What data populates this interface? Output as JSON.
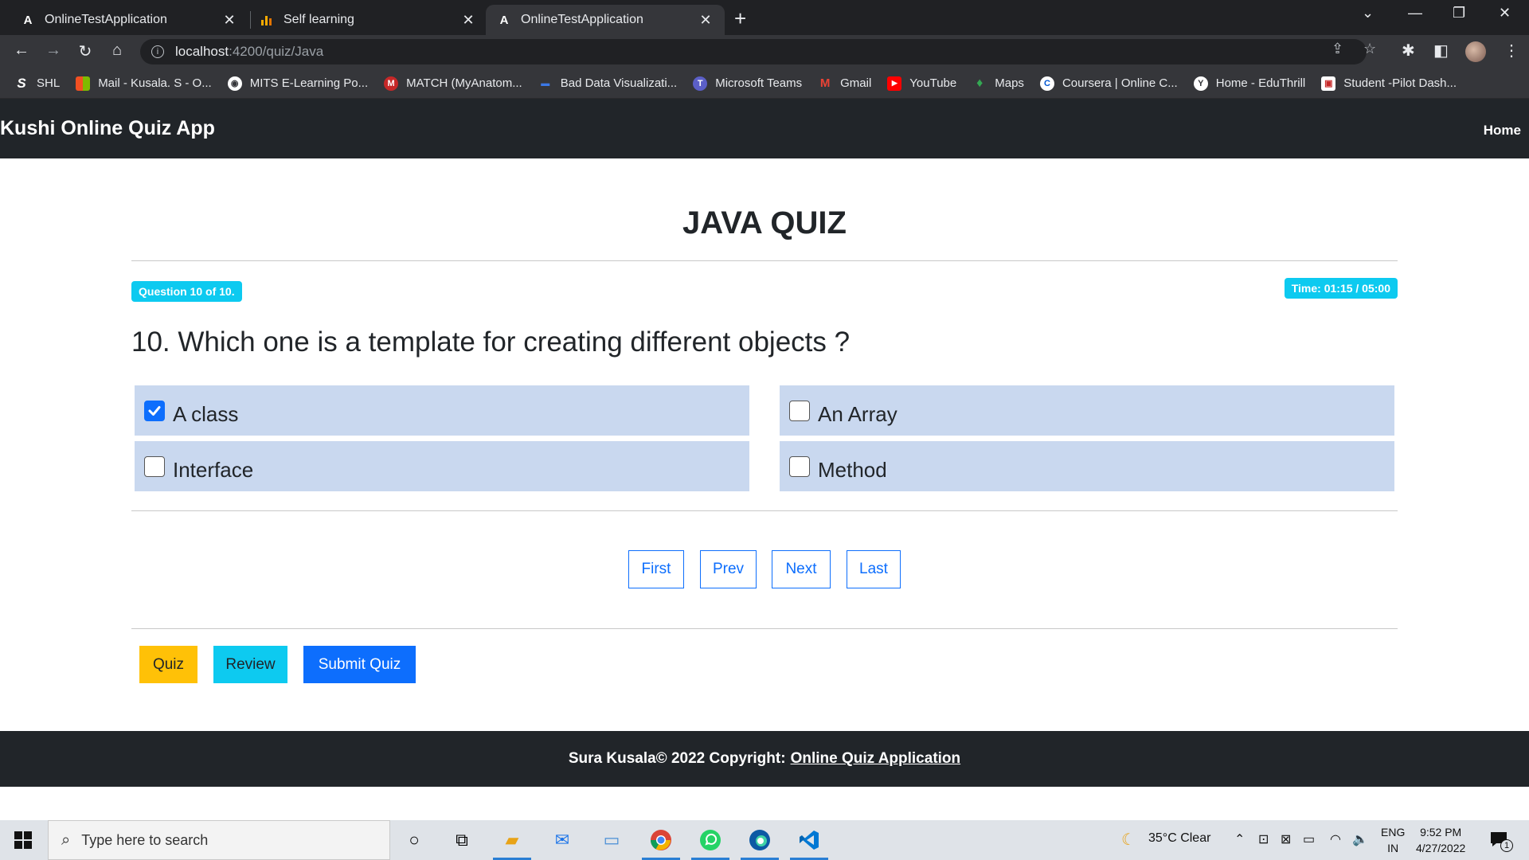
{
  "browser": {
    "tabs": [
      {
        "title": "OnlineTestApplication",
        "icon": "angular-icon"
      },
      {
        "title": "Self learning",
        "icon": "chart-icon"
      },
      {
        "title": "OnlineTestApplication",
        "icon": "angular-icon",
        "active": true
      }
    ],
    "address": {
      "host": "localhost",
      "path": ":4200/quiz/Java"
    },
    "bookmarks": [
      {
        "label": "SHL",
        "icon": "S",
        "color": "#35363a"
      },
      {
        "label": "Mail - Kusala. S - O...",
        "icon": "▦",
        "color": "#f25022"
      },
      {
        "label": "MITS E-Learning Po...",
        "icon": "◉",
        "color": "#35363a"
      },
      {
        "label": "MATCH (MyAnatom...",
        "icon": "M",
        "color": "#c62828"
      },
      {
        "label": "Bad Data Visualizati...",
        "icon": "▬",
        "color": "#35363a"
      },
      {
        "label": "Microsoft Teams",
        "icon": "T",
        "color": "#5b5fc7"
      },
      {
        "label": "Gmail",
        "icon": "M",
        "color": "#ea4335"
      },
      {
        "label": "YouTube",
        "icon": "▶",
        "color": "#ff0000"
      },
      {
        "label": "Maps",
        "icon": "♦",
        "color": "#34a853"
      },
      {
        "label": "Coursera | Online C...",
        "icon": "C",
        "color": "#0056d2"
      },
      {
        "label": "Home - EduThrill",
        "icon": "Y",
        "color": "#35363a"
      },
      {
        "label": "Student -Pilot Dash...",
        "icon": "▣",
        "color": "#c62828"
      }
    ]
  },
  "app": {
    "brand": "Kushi Online Quiz App",
    "nav_home": "Home",
    "title": "JAVA QUIZ",
    "question_badge": "Question 10 of 10.",
    "timer_badge": "Time: 01:15 / 05:00",
    "question": "10. Which one is a template for creating different objects ?",
    "options": [
      {
        "label": "A class",
        "checked": true
      },
      {
        "label": "An Array",
        "checked": false
      },
      {
        "label": "Interface",
        "checked": false
      },
      {
        "label": "Method",
        "checked": false
      }
    ],
    "pager": {
      "first": "First",
      "prev": "Prev",
      "next": "Next",
      "last": "Last"
    },
    "actions": {
      "quiz": "Quiz",
      "review": "Review",
      "submit": "Submit Quiz"
    },
    "footer": {
      "text": "Sura Kusala© 2022 Copyright:",
      "link": "Online Quiz Application"
    }
  },
  "taskbar": {
    "search_placeholder": "Type here to search",
    "weather": "35°C  Clear",
    "lang_top": "ENG",
    "lang_bottom": "IN",
    "time": "9:52 PM",
    "date": "4/27/2022",
    "notification_count": "1"
  },
  "colors": {
    "navbar": "#212529",
    "badge": "#0dcaf0",
    "option_bg": "#c9d8ef",
    "primary": "#0d6efd",
    "warning": "#ffc107",
    "info": "#0dcaf0"
  }
}
